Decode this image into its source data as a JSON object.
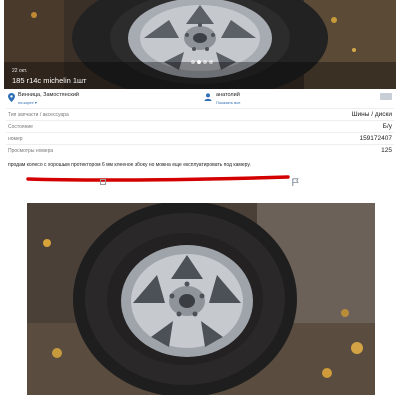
{
  "listing": {
    "photo_date": "22 окт.",
    "title": "185 r14c michelin 1шт",
    "photo_count_dots": 4,
    "active_dot": 1
  },
  "location": {
    "city": "Винница, Замостянский",
    "map_link": "на карте ▾"
  },
  "seller": {
    "name": "анатолий",
    "show_all": "Показать все"
  },
  "attributes": [
    {
      "label": "Тип запчасти / аксессуара",
      "value": "Шины / диски"
    },
    {
      "label": "Состояние",
      "value": "Б/у"
    },
    {
      "label": "номер",
      "value": "159172407"
    },
    {
      "label": "Просмотры номера",
      "value": "125"
    }
  ],
  "description": "продам колесо с хорошым протектором 6 мм клееное збоку но можна еще експлуатировать под камеру.",
  "colors": {
    "accent_red": "#d40000",
    "link_blue": "#2f6fb5",
    "wheel_silver": "#b9bcc2",
    "tire_dark": "#2b2a2a"
  },
  "icons": {
    "location": "map-pin-icon",
    "seller": "person-icon",
    "checkbox": "checkbox-icon",
    "report": "flag-icon"
  }
}
